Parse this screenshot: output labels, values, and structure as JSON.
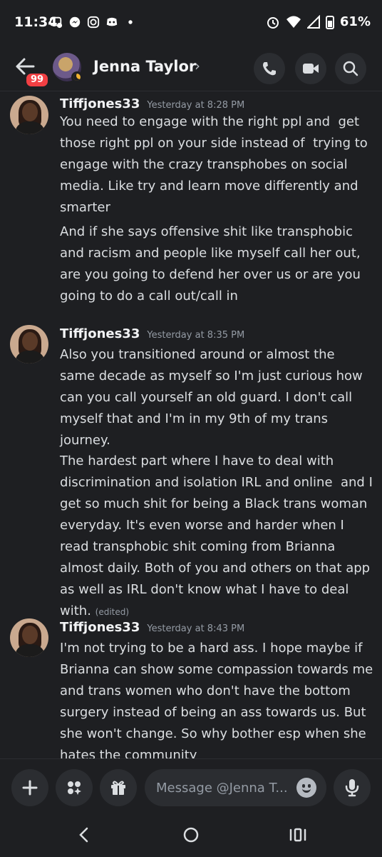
{
  "status_bar": {
    "time": "11:34",
    "battery": "61%"
  },
  "header": {
    "unread_badge": "99",
    "contact_name": "Jenna Taylor",
    "chevron": "›"
  },
  "messages": [
    {
      "author": "Tiffjones33",
      "timestamp": "Yesterday at 8:28 PM",
      "paragraphs": [
        "You need to engage with the right ppl and  get those right ppl on your side instead of  trying to engage with the crazy transphobes on social media. Like try and learn move differently and smarter",
        "And if she says offensive shit like transphobic and racism and people like myself call her out, are you going to defend her over us or are you going to do a call out/call in"
      ]
    },
    {
      "author": "Tiffjones33",
      "timestamp": "Yesterday at 8:35 PM",
      "paragraphs": [
        "Also you transitioned around or almost the same decade as myself so I'm just curious how can you call yourself an old guard. I don't call myself that and I'm in my 9th of my trans journey.",
        "The hardest part where I have to deal with discrimination and isolation IRL and online  and I get so much shit for being a Black trans woman everyday. It's even worse and harder when I read transphobic shit coming from Brianna almost daily. Both of you and others on that app as well as IRL don't know what I have to deal with."
      ],
      "edited_label": "(edited)"
    },
    {
      "author": "Tiffjones33",
      "timestamp": "Yesterday at 8:43 PM",
      "paragraphs": [
        "I'm not trying to be a hard ass. I hope maybe if Brianna can show some compassion towards me and trans women who don't have the bottom surgery instead of being an ass towards us. But she won't change. So why bother esp when she hates the community"
      ]
    }
  ],
  "input": {
    "placeholder": "Message @Jenna T..."
  },
  "icons": {
    "accent": "#5865f2",
    "background": "#1e1f22",
    "surface": "#2b2d31",
    "badge": "#f23f43"
  }
}
